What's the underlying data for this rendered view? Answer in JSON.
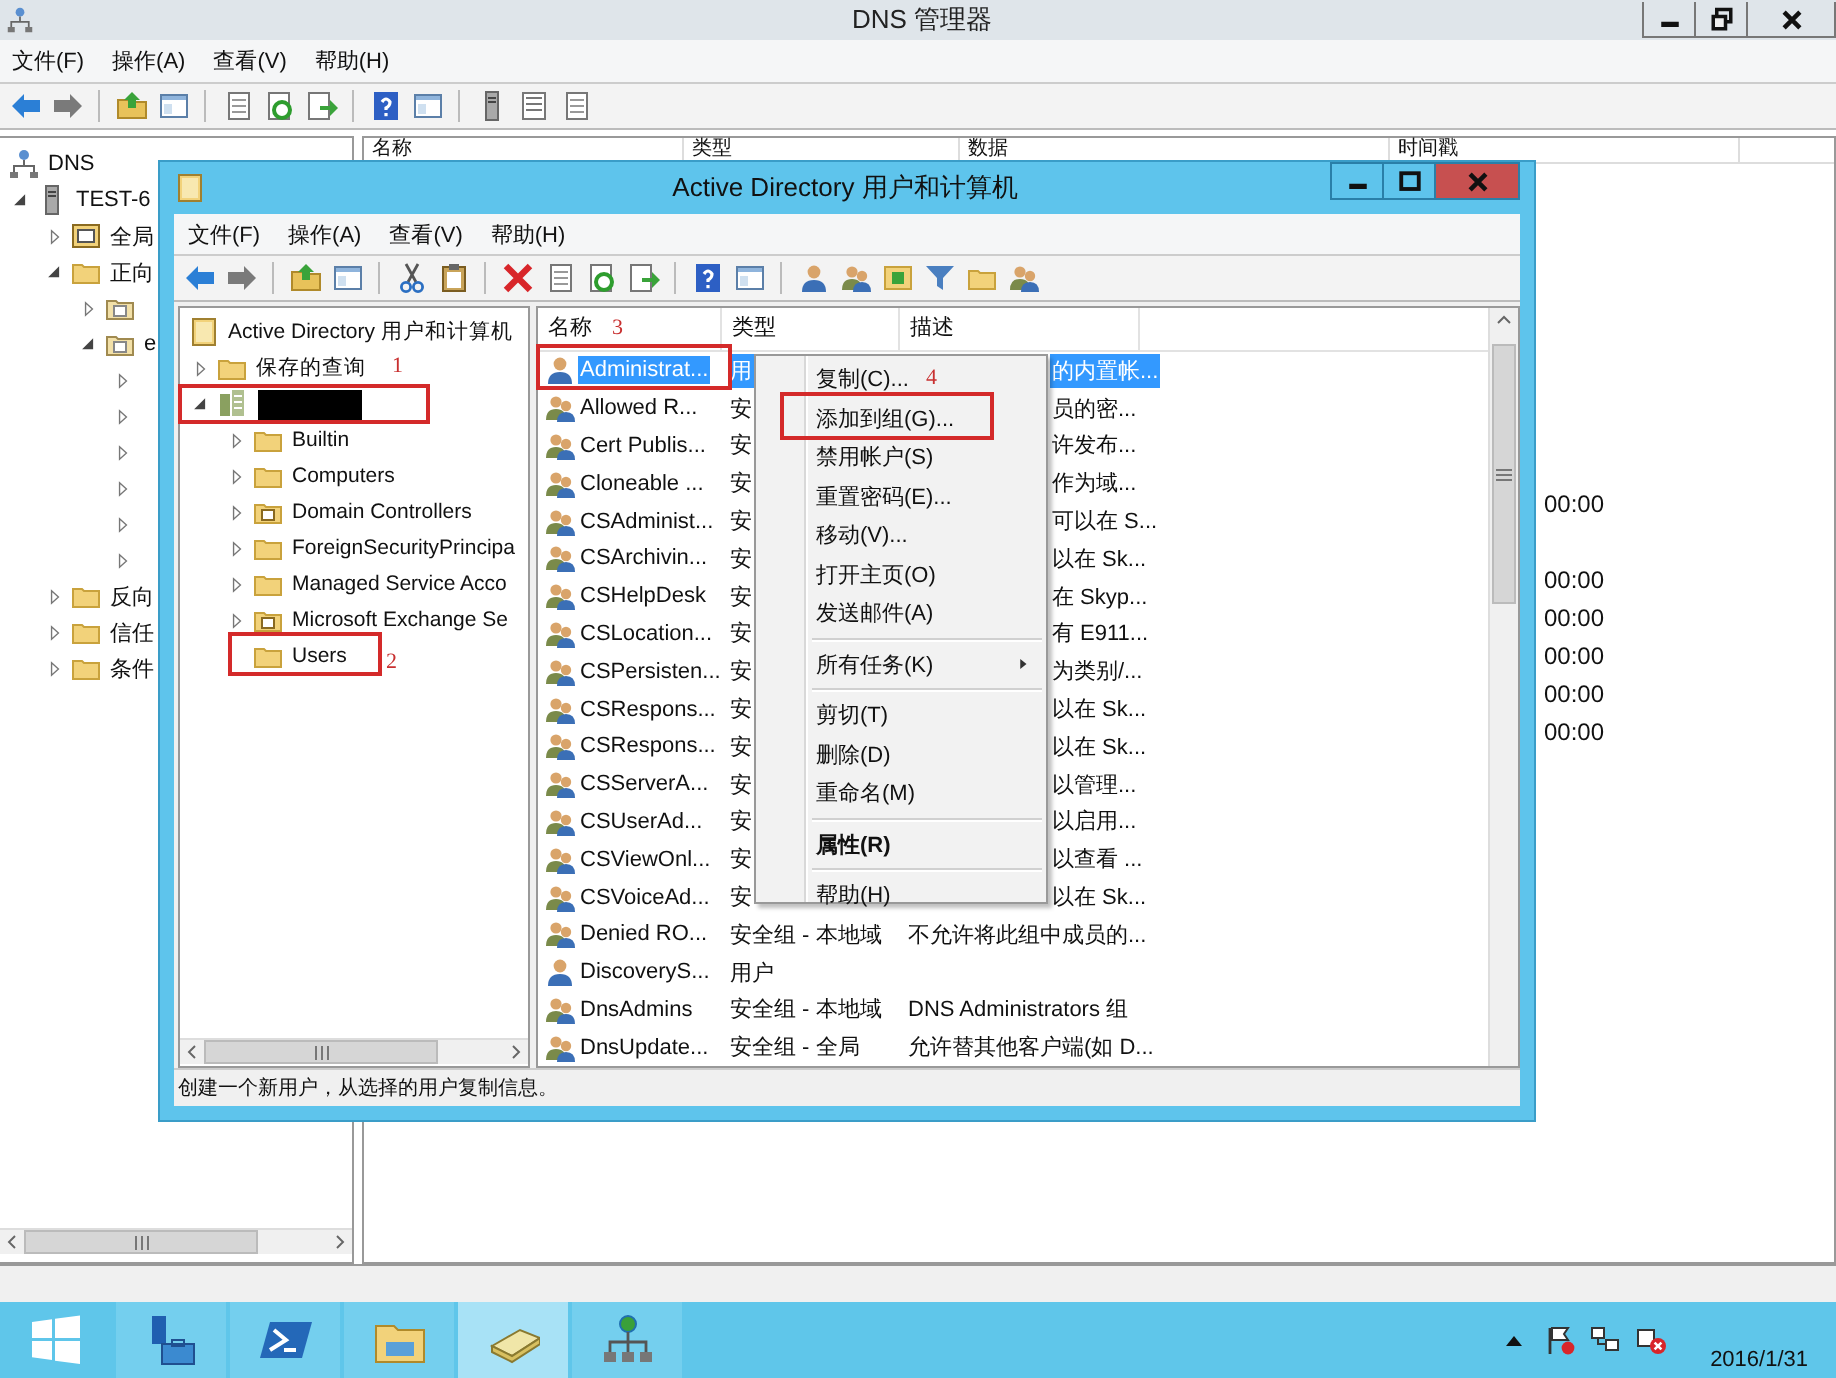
{
  "dns_window": {
    "title": "DNS 管理器",
    "menu": [
      "文件(F)",
      "操作(A)",
      "查看(V)",
      "帮助(H)"
    ],
    "tree": [
      {
        "label": "DNS",
        "kind": "dns",
        "children": [
          {
            "label": "TEST-6",
            "kind": "server",
            "expanded": true,
            "children": [
              {
                "label": "全局",
                "kind": "log",
                "expanded": false
              },
              {
                "label": "正向",
                "kind": "folder",
                "expanded": true,
                "children": [
                  {
                    "kind": "zone",
                    "expanded": false
                  },
                  {
                    "label": "e",
                    "kind": "zone",
                    "expanded": true,
                    "children": [
                      {
                        "expanded": false
                      },
                      {
                        "expanded": false
                      },
                      {
                        "expanded": false
                      },
                      {
                        "expanded": false
                      },
                      {
                        "expanded": false
                      },
                      {
                        "expanded": false
                      }
                    ]
                  }
                ]
              },
              {
                "label": "反向",
                "kind": "folder",
                "expanded": false
              },
              {
                "label": "信任",
                "kind": "folder",
                "expanded": false
              },
              {
                "label": "条件",
                "kind": "folder",
                "expanded": false
              }
            ]
          }
        ]
      }
    ],
    "columns": [
      "名称",
      "类型",
      "数据",
      "时间戳"
    ],
    "rows": [
      {},
      {},
      {},
      {},
      {},
      {},
      {},
      {},
      {
        "timestamp": "00:00"
      },
      {},
      {
        "timestamp": "00:00"
      },
      {
        "timestamp": "00:00"
      },
      {
        "timestamp": "00:00"
      },
      {
        "timestamp": "00:00"
      },
      {
        "timestamp": "00:00"
      }
    ]
  },
  "ad_window": {
    "title": "Active Directory 用户和计算机",
    "menu": [
      "文件(F)",
      "操作(A)",
      "查看(V)",
      "帮助(H)"
    ],
    "tree": [
      {
        "label": "Active Directory 用户和计算机",
        "kind": "root",
        "children": [
          {
            "label": "保存的查询",
            "kind": "folder",
            "expanded": false
          },
          {
            "kind": "domain",
            "redacted": true,
            "expanded": true,
            "children": [
              {
                "label": "Builtin",
                "kind": "folder",
                "expanded": false
              },
              {
                "label": "Computers",
                "kind": "folder",
                "expanded": false
              },
              {
                "label": "Domain Controllers",
                "kind": "ou",
                "expanded": false
              },
              {
                "label": "ForeignSecurityPrincipa",
                "kind": "folder",
                "expanded": false
              },
              {
                "label": "Managed Service Acco",
                "kind": "folder",
                "expanded": false
              },
              {
                "label": "Microsoft Exchange Se",
                "kind": "ou",
                "expanded": false
              },
              {
                "label": "Users",
                "kind": "folder"
              }
            ]
          }
        ]
      }
    ],
    "columns": [
      "名称",
      "类型",
      "描述"
    ],
    "rows": [
      {
        "kind": "user",
        "name": "Administrat...",
        "type": "用",
        "description": "的内置帐...",
        "selected": true
      },
      {
        "kind": "group",
        "name": "Allowed R...",
        "type": "安",
        "description": "员的密...",
        "selected": false
      },
      {
        "kind": "group",
        "name": "Cert Publis...",
        "type": "安",
        "description": "许发布...",
        "selected": false
      },
      {
        "kind": "group",
        "name": "Cloneable ...",
        "type": "安",
        "description": "作为域...",
        "selected": false
      },
      {
        "kind": "group",
        "name": "CSAdminist...",
        "type": "安",
        "description": "可以在 S...",
        "selected": false
      },
      {
        "kind": "group",
        "name": "CSArchivin...",
        "type": "安",
        "description": "以在 Sk...",
        "selected": false
      },
      {
        "kind": "group",
        "name": "CSHelpDesk",
        "type": "安",
        "description": "在 Skyp...",
        "selected": false
      },
      {
        "kind": "group",
        "name": "CSLocation...",
        "type": "安",
        "description": "有 E911...",
        "selected": false
      },
      {
        "kind": "group",
        "name": "CSPersisten...",
        "type": "安",
        "description": "为类别/...",
        "selected": false
      },
      {
        "kind": "group",
        "name": "CSRespons...",
        "type": "安",
        "description": "以在 Sk...",
        "selected": false
      },
      {
        "kind": "group",
        "name": "CSRespons...",
        "type": "安",
        "description": "以在 Sk...",
        "selected": false
      },
      {
        "kind": "group",
        "name": "CSServerA...",
        "type": "安",
        "description": "以管理...",
        "selected": false
      },
      {
        "kind": "group",
        "name": "CSUserAd...",
        "type": "安",
        "description": "以启用...",
        "selected": false
      },
      {
        "kind": "group",
        "name": "CSViewOnl...",
        "type": "安",
        "description": "以查看 ...",
        "selected": false
      },
      {
        "kind": "group",
        "name": "CSVoiceAd...",
        "type": "安",
        "description": "以在 Sk...",
        "selected": false
      },
      {
        "kind": "group",
        "name": "Denied RO...",
        "type": "安全组 - 本地域",
        "description": "不允许将此组中成员的...",
        "selected": false
      },
      {
        "kind": "user",
        "name": "DiscoveryS...",
        "type": "用户",
        "selected": false
      },
      {
        "kind": "group",
        "name": "DnsAdmins",
        "type": "安全组 - 本地域",
        "description": "DNS Administrators 组",
        "selected": false
      },
      {
        "kind": "group",
        "name": "DnsUpdate...",
        "type": "安全组 - 全局",
        "description": "允许替其他客户端(如 D...",
        "selected": false
      }
    ],
    "status": "创建一个新用户，从选择的用户复制信息。"
  },
  "context_menu": [
    {
      "kind": "item",
      "label": "复制(C)..."
    },
    {
      "kind": "item",
      "label": "添加到组(G)..."
    },
    {
      "kind": "item",
      "label": "禁用帐户(S)"
    },
    {
      "kind": "item",
      "label": "重置密码(E)..."
    },
    {
      "kind": "item",
      "label": "移动(V)..."
    },
    {
      "kind": "item",
      "label": "打开主页(O)"
    },
    {
      "kind": "item",
      "label": "发送邮件(A)"
    },
    {
      "kind": "separator"
    },
    {
      "kind": "item",
      "label": "所有任务(K)",
      "submenu": true
    },
    {
      "kind": "separator"
    },
    {
      "kind": "item",
      "label": "剪切(T)"
    },
    {
      "kind": "item",
      "label": "删除(D)"
    },
    {
      "kind": "item",
      "label": "重命名(M)"
    },
    {
      "kind": "separator"
    },
    {
      "kind": "item",
      "label": "属性(R)",
      "default": true
    },
    {
      "kind": "separator"
    },
    {
      "kind": "item",
      "label": "帮助(H)"
    }
  ],
  "annotations": [
    {
      "number": "1"
    },
    {
      "number": "2"
    },
    {
      "number": "3"
    },
    {
      "number": "4"
    }
  ],
  "taskbar": {
    "apps": [
      {
        "kind": "server-manager",
        "selected": false
      },
      {
        "kind": "powershell",
        "selected": false
      },
      {
        "kind": "explorer",
        "selected": false
      },
      {
        "kind": "directory",
        "selected": true
      },
      {
        "kind": "network",
        "selected": false
      }
    ],
    "date": "2016/1/31"
  }
}
